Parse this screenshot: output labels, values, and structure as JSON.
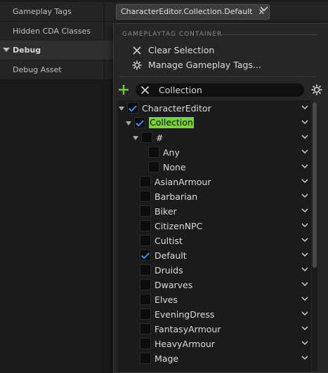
{
  "details": {
    "rows": [
      {
        "label": "Gameplay Tags"
      },
      {
        "label": "Hidden CDA Classes"
      }
    ],
    "category": {
      "label": "Debug"
    },
    "debug_row": {
      "label": "Debug Asset"
    },
    "tag_value": "CharacterEditor.Collection.Default"
  },
  "popup": {
    "section_title": "GAMEPLAYTAG CONTAINER",
    "menu": {
      "clear": "Clear Selection",
      "manage": "Manage Gameplay Tags..."
    },
    "search": {
      "value": "Collection"
    },
    "tree": [
      {
        "label": "CharacterEditor",
        "checked": true,
        "expanded": true,
        "depth": 0,
        "has_children": true
      },
      {
        "label": "Collection",
        "checked": true,
        "expanded": true,
        "depth": 1,
        "has_children": true,
        "highlight": true
      },
      {
        "label": "#",
        "checked": false,
        "expanded": true,
        "depth": 2,
        "has_children": true
      },
      {
        "label": "Any",
        "checked": false,
        "depth": 3,
        "has_children": false
      },
      {
        "label": "None",
        "checked": false,
        "depth": 3,
        "has_children": false
      },
      {
        "label": "AsianArmour",
        "checked": false,
        "depth": 2,
        "has_children": false
      },
      {
        "label": "Barbarian",
        "checked": false,
        "depth": 2,
        "has_children": false
      },
      {
        "label": "Biker",
        "checked": false,
        "depth": 2,
        "has_children": false
      },
      {
        "label": "CitizenNPC",
        "checked": false,
        "depth": 2,
        "has_children": false
      },
      {
        "label": "Cultist",
        "checked": false,
        "depth": 2,
        "has_children": false
      },
      {
        "label": "Default",
        "checked": true,
        "depth": 2,
        "has_children": false
      },
      {
        "label": "Druids",
        "checked": false,
        "depth": 2,
        "has_children": false
      },
      {
        "label": "Dwarves",
        "checked": false,
        "depth": 2,
        "has_children": false
      },
      {
        "label": "Elves",
        "checked": false,
        "depth": 2,
        "has_children": false
      },
      {
        "label": "EveningDress",
        "checked": false,
        "depth": 2,
        "has_children": false
      },
      {
        "label": "FantasyArmour",
        "checked": false,
        "depth": 2,
        "has_children": false
      },
      {
        "label": "HeavyArmour",
        "checked": false,
        "depth": 2,
        "has_children": false
      },
      {
        "label": "Mage",
        "checked": false,
        "depth": 2,
        "has_children": false
      }
    ],
    "colors": {
      "accent_check": "#3d8fe8",
      "search_highlight": "#7bd13a",
      "add_button": "#6fd13a"
    }
  }
}
